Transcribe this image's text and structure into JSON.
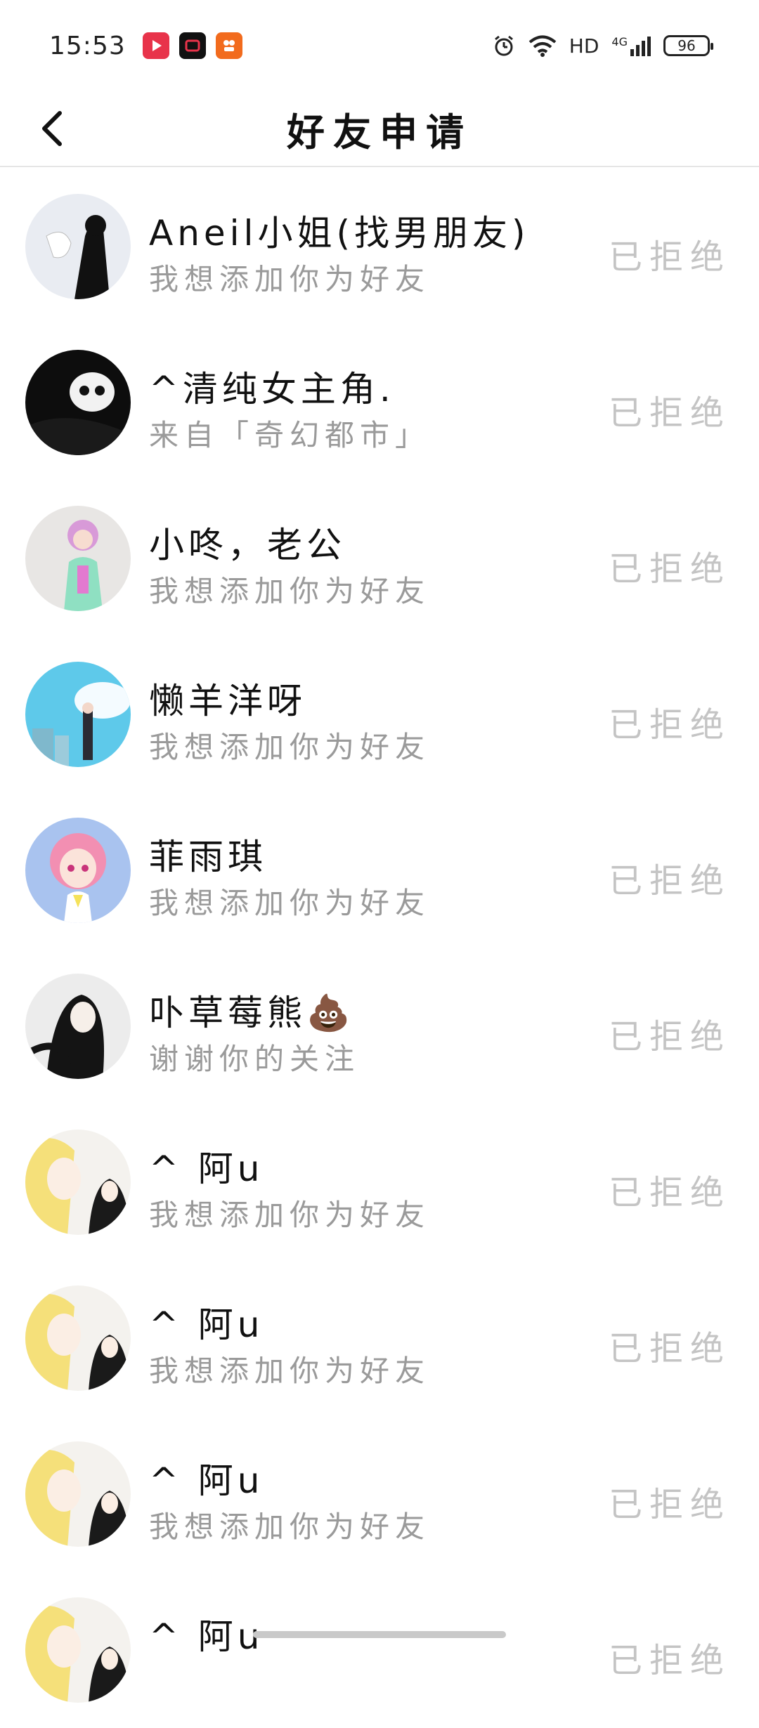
{
  "status_bar": {
    "time": "15:53",
    "network": "HD",
    "network_type": "4G",
    "battery": "96"
  },
  "header": {
    "title": "好友申请"
  },
  "requests": [
    {
      "name": "Aneil小姐(找男朋友)",
      "message": "我想添加你为好友",
      "status": "已拒绝",
      "avatar": "avatar-white-girl"
    },
    {
      "name": "^清纯女主角.",
      "message": "来自「奇幻都市」",
      "status": "已拒绝",
      "avatar": "avatar-dark-skull"
    },
    {
      "name": "小咚，老公",
      "message": "我想添加你为好友",
      "status": "已拒绝",
      "avatar": "avatar-pastel-girl"
    },
    {
      "name": "懒羊洋呀",
      "message": "我想添加你为好友",
      "status": "已拒绝",
      "avatar": "avatar-sky-girl"
    },
    {
      "name": "菲雨琪",
      "message": "我想添加你为好友",
      "status": "已拒绝",
      "avatar": "avatar-pink-hair"
    },
    {
      "name": "卟草莓熊💩",
      "message": "谢谢你的关注",
      "status": "已拒绝",
      "avatar": "avatar-black-hair"
    },
    {
      "name": "^ 阿u",
      "message": "我想添加你为好友",
      "status": "已拒绝",
      "avatar": "avatar-blonde-duo"
    },
    {
      "name": "^ 阿u",
      "message": "我想添加你为好友",
      "status": "已拒绝",
      "avatar": "avatar-blonde-duo"
    },
    {
      "name": "^ 阿u",
      "message": "我想添加你为好友",
      "status": "已拒绝",
      "avatar": "avatar-blonde-duo"
    },
    {
      "name": "^ 阿u",
      "message": "",
      "status": "已拒绝",
      "avatar": "avatar-blonde-duo"
    }
  ],
  "colors": {
    "accent_red": "#e8334a",
    "accent_orange": "#f26b1d",
    "muted_text": "#9a9a9a",
    "status_text": "#c4c4c4"
  }
}
